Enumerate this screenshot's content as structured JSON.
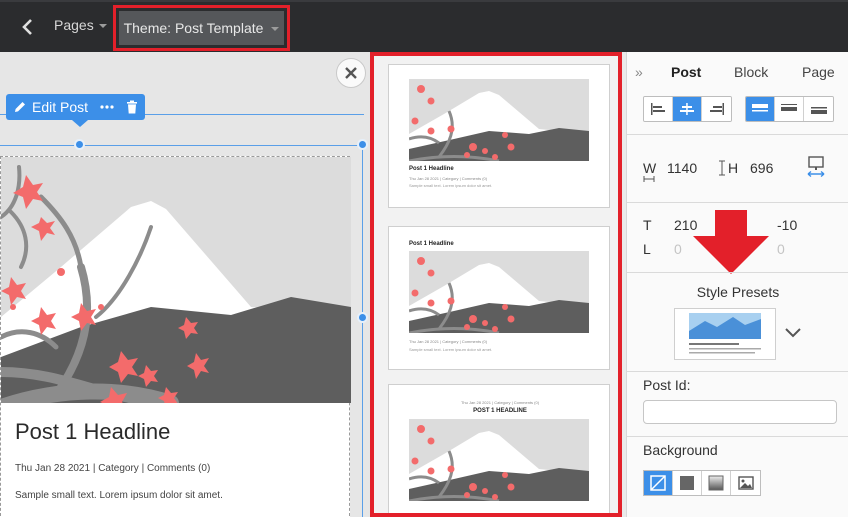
{
  "topbar": {
    "pages_label": "Pages",
    "theme_label": "Theme: Post Template"
  },
  "canvas": {
    "toolbar": {
      "edit_label": "Edit Post"
    },
    "post": {
      "headline": "Post 1 Headline",
      "meta": "Thu Jan 28 2021  |  Category  |  Comments (0)",
      "body": "Sample small text. Lorem ipsum dolor sit amet."
    }
  },
  "templates": [
    {
      "headline": "Post 1 Headline",
      "meta": "Thu Jan 28 2021 | Category | Comments (0)",
      "body": "Sample small text. Lorem ipsum dolor sit amet."
    },
    {
      "headline": "Post 1 Headline",
      "meta": "Thu Jan 28 2021 | Category | Comments (0)",
      "body": "Sample small text. Lorem ipsum dolor sit amet."
    },
    {
      "headline": "POST 1 HEADLINE",
      "meta": "Thu Jan 28 2021 | Category | Comments (0)",
      "body": "Sample small text. Lorem ipsum dolor sit amet."
    }
  ],
  "panel": {
    "tabs": [
      "Post",
      "Block",
      "Page"
    ],
    "w_label": "W",
    "w_value": "1140",
    "h_label": "H",
    "h_value": "696",
    "t_label": "T",
    "t_value": "210",
    "t_right": "-10",
    "l_label": "L",
    "l_value": "0",
    "l_right": "0",
    "style_presets": "Style Presets",
    "post_id_label": "Post Id:",
    "post_id_value": "",
    "background_label": "Background"
  },
  "colors": {
    "accent": "#3c8fe8",
    "highlight": "#e3202a",
    "blossom": "#f36b6b",
    "topbar": "#2b2c2e"
  }
}
